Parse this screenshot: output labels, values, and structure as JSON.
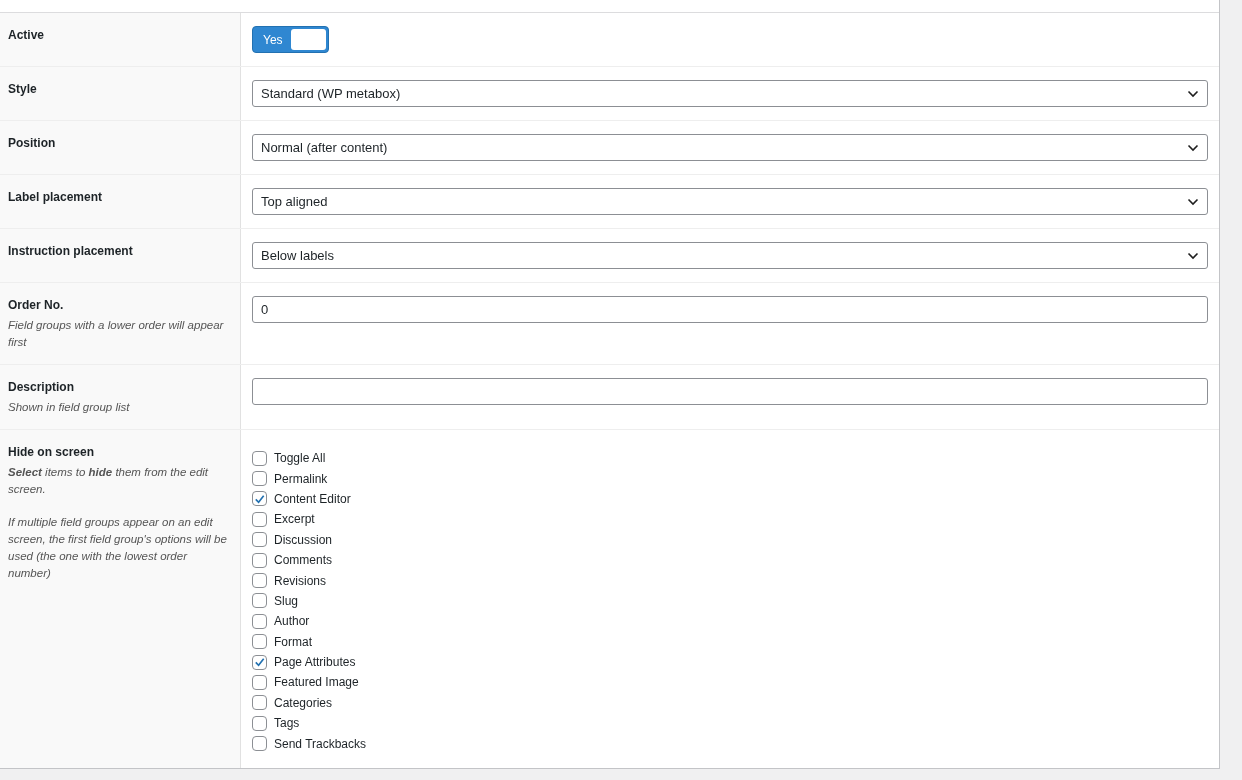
{
  "settings": [
    {
      "kind": "toggle",
      "label": "Active",
      "toggle": {
        "label": "Yes",
        "on": true
      }
    },
    {
      "kind": "select",
      "label": "Style",
      "value": "Standard (WP metabox)"
    },
    {
      "kind": "select",
      "label": "Position",
      "value": "Normal (after content)"
    },
    {
      "kind": "select",
      "label": "Label placement",
      "value": "Top aligned"
    },
    {
      "kind": "select",
      "label": "Instruction placement",
      "value": "Below labels"
    },
    {
      "kind": "text",
      "label": "Order No.",
      "instructions": [
        "Field groups with a lower order will appear first"
      ],
      "value": "0"
    },
    {
      "kind": "text",
      "label": "Description",
      "instructions": [
        "Shown in field group list"
      ]
    },
    {
      "kind": "checkboxes",
      "label": "Hide on screen",
      "instructions": [
        "**Select** items to **hide** them from the edit screen.",
        "If multiple field groups appear on an edit screen, the first field group's options will be used (the one with the lowest order number)"
      ],
      "options": [
        {
          "label": "Toggle All",
          "checked": false
        },
        {
          "label": "Permalink",
          "checked": false
        },
        {
          "label": "Content Editor",
          "checked": true
        },
        {
          "label": "Excerpt",
          "checked": false
        },
        {
          "label": "Discussion",
          "checked": false
        },
        {
          "label": "Comments",
          "checked": false
        },
        {
          "label": "Revisions",
          "checked": false
        },
        {
          "label": "Slug",
          "checked": false
        },
        {
          "label": "Author",
          "checked": false
        },
        {
          "label": "Format",
          "checked": false
        },
        {
          "label": "Page Attributes",
          "checked": true
        },
        {
          "label": "Featured Image",
          "checked": false
        },
        {
          "label": "Categories",
          "checked": false
        },
        {
          "label": "Tags",
          "checked": false
        },
        {
          "label": "Send Trackbacks",
          "checked": false
        }
      ]
    }
  ]
}
